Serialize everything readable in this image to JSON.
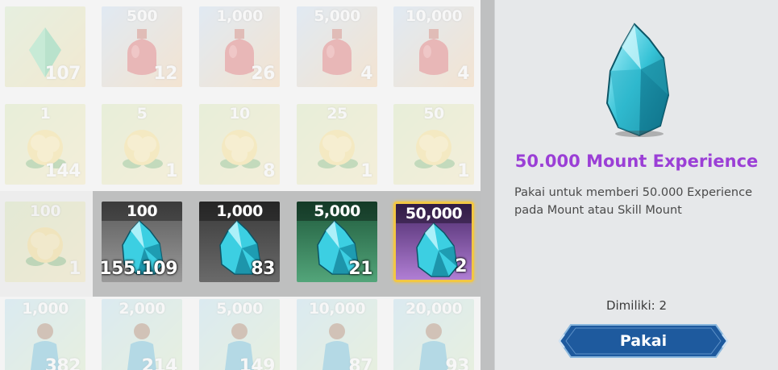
{
  "inventory": {
    "row1": [
      {
        "top": "",
        "count": "107",
        "kind": "green-potion"
      },
      {
        "top": "500",
        "count": "12",
        "kind": "red-potion"
      },
      {
        "top": "1,000",
        "count": "26",
        "kind": "red-potion"
      },
      {
        "top": "5,000",
        "count": "4",
        "kind": "red-potion"
      },
      {
        "top": "10,000",
        "count": "4",
        "kind": "red-potion"
      }
    ],
    "row2": [
      {
        "top": "1",
        "count": "144",
        "kind": "yellow-flower"
      },
      {
        "top": "5",
        "count": "1",
        "kind": "yellow-flower"
      },
      {
        "top": "10",
        "count": "8",
        "kind": "yellow-flower"
      },
      {
        "top": "25",
        "count": "1",
        "kind": "yellow-flower"
      },
      {
        "top": "50",
        "count": "1",
        "kind": "yellow-flower"
      }
    ],
    "row3": [
      {
        "top": "100",
        "count": "1",
        "kind": "yellow-flower"
      },
      {
        "top": "100",
        "count": "155.109",
        "kind": "crystal",
        "bg": "gray"
      },
      {
        "top": "1,000",
        "count": "83",
        "kind": "crystal",
        "bg": "dark"
      },
      {
        "top": "5,000",
        "count": "21",
        "kind": "crystal",
        "bg": "green"
      },
      {
        "top": "50,000",
        "count": "2",
        "kind": "crystal",
        "bg": "purple"
      }
    ],
    "row4": [
      {
        "top": "1,000",
        "count": "382",
        "kind": "blue-figure"
      },
      {
        "top": "2,000",
        "count": "214",
        "kind": "blue-figure"
      },
      {
        "top": "5,000",
        "count": "149",
        "kind": "blue-figure"
      },
      {
        "top": "10,000",
        "count": "87",
        "kind": "blue-figure"
      },
      {
        "top": "20,000",
        "count": "93",
        "kind": "blue-figure"
      }
    ]
  },
  "detail": {
    "title": "50.000 Mount Experience",
    "description": "Pakai untuk memberi 50.000 Experience pada Mount atau Skill Mount",
    "owned": "Dimiliki: 2",
    "use_label": "Pakai",
    "icon": "cyan-crystal-icon"
  },
  "colors": {
    "title_purple": "#9b3fd6",
    "select_gold": "#f2c744",
    "button_blue": "#1e5a9e"
  }
}
